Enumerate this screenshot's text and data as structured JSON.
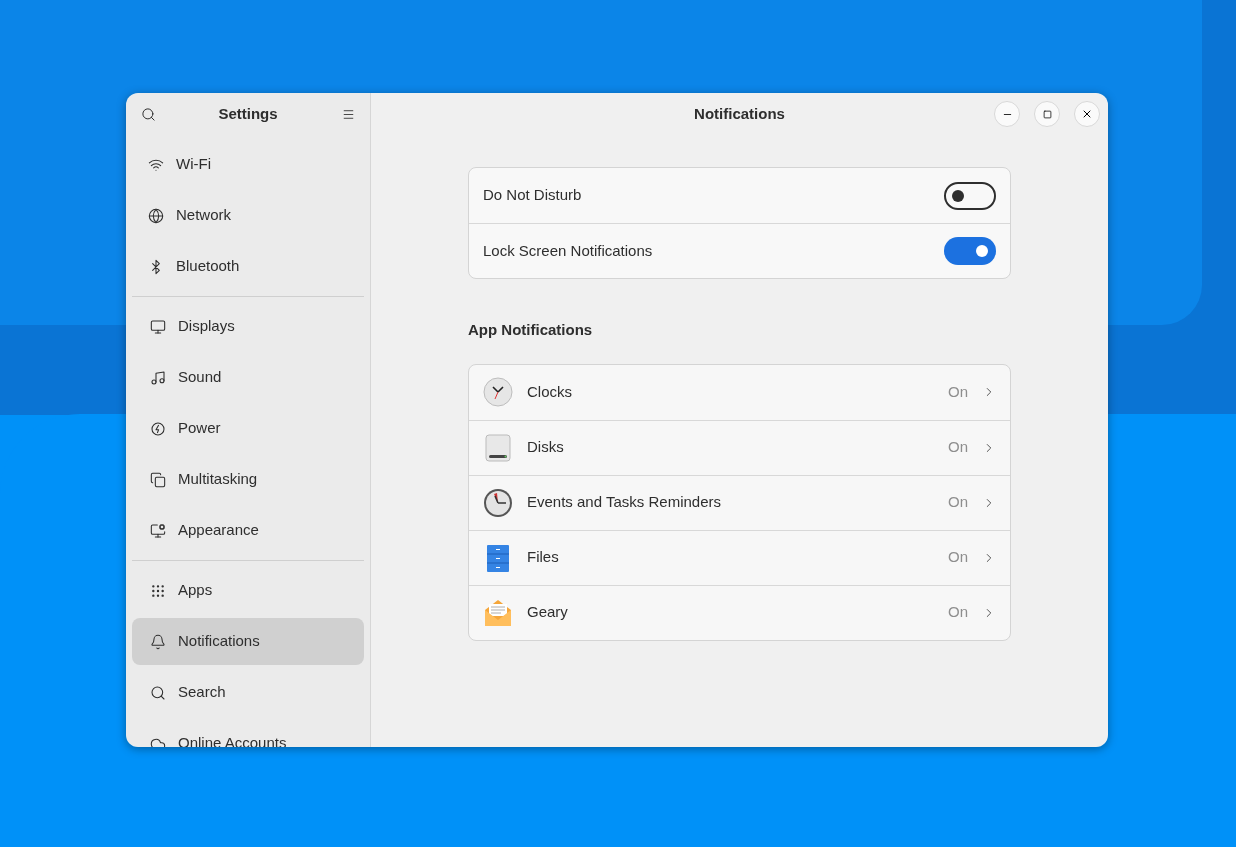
{
  "sidebar": {
    "title": "Settings",
    "groups": [
      [
        {
          "label": "Wi-Fi",
          "selected": false
        },
        {
          "label": "Network",
          "selected": false
        },
        {
          "label": "Bluetooth",
          "selected": false
        }
      ],
      [
        {
          "label": "Displays",
          "selected": false
        },
        {
          "label": "Sound",
          "selected": false
        },
        {
          "label": "Power",
          "selected": false
        },
        {
          "label": "Multitasking",
          "selected": false
        },
        {
          "label": "Appearance",
          "selected": false
        }
      ],
      [
        {
          "label": "Apps",
          "selected": false
        },
        {
          "label": "Notifications",
          "selected": true
        },
        {
          "label": "Search",
          "selected": false
        },
        {
          "label": "Online Accounts",
          "selected": false
        }
      ]
    ]
  },
  "window": {
    "title": "Notifications"
  },
  "toggles": [
    {
      "label": "Do Not Disturb",
      "on": false
    },
    {
      "label": "Lock Screen Notifications",
      "on": true
    }
  ],
  "app_notifications": {
    "heading": "App Notifications",
    "rows": [
      {
        "name": "Clocks",
        "status": "On"
      },
      {
        "name": "Disks",
        "status": "On"
      },
      {
        "name": "Events and Tasks Reminders",
        "status": "On"
      },
      {
        "name": "Files",
        "status": "On"
      },
      {
        "name": "Geary",
        "status": "On"
      }
    ]
  }
}
